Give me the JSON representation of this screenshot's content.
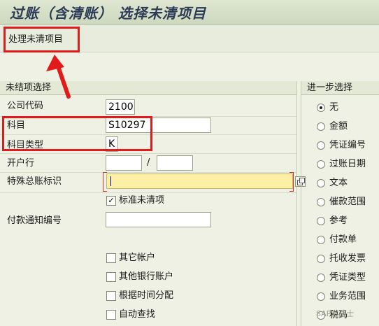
{
  "window": {
    "title": "过账（含清账） 选择未清项目"
  },
  "toolbar": {
    "process_open_items": "处理未清项目"
  },
  "open_item_selection": {
    "header": "未结项选择",
    "company_code": {
      "label": "公司代码",
      "value": "2100"
    },
    "account": {
      "label": "科目",
      "value": "S10297"
    },
    "account_type": {
      "label": "科目类型",
      "value": "K"
    },
    "house_bank": {
      "label": "开户行",
      "value1": "",
      "separator": "/",
      "value2": ""
    },
    "special_gl_ind": {
      "label": "特殊总账标识",
      "value": ""
    },
    "standard_open_items": {
      "label": "标准未清项",
      "checked": true
    },
    "payment_advice_no": {
      "label": "付款通知编号",
      "value": ""
    },
    "other_accounts": {
      "label": "其它帐户",
      "checked": false
    },
    "other_bank_accounts": {
      "label": "其他银行账户",
      "checked": false
    },
    "distribute_by_age": {
      "label": "根据时间分配",
      "checked": false
    },
    "auto_search": {
      "label": "自动查找",
      "checked": false
    }
  },
  "further_selection": {
    "header": "进一步选择",
    "options": [
      {
        "label": "无",
        "selected": true
      },
      {
        "label": "金额",
        "selected": false
      },
      {
        "label": "凭证编号",
        "selected": false
      },
      {
        "label": "过账日期",
        "selected": false
      },
      {
        "label": "文本",
        "selected": false
      },
      {
        "label": "催款范围",
        "selected": false
      },
      {
        "label": "参考",
        "selected": false
      },
      {
        "label": "付款单",
        "selected": false
      },
      {
        "label": "托收发票",
        "selected": false
      },
      {
        "label": "凭证类型",
        "selected": false
      },
      {
        "label": "业务范围",
        "selected": false
      },
      {
        "label": "税码",
        "selected": false
      }
    ]
  },
  "annotation_color": "#e11b1b",
  "watermark": "SAP玄战士"
}
